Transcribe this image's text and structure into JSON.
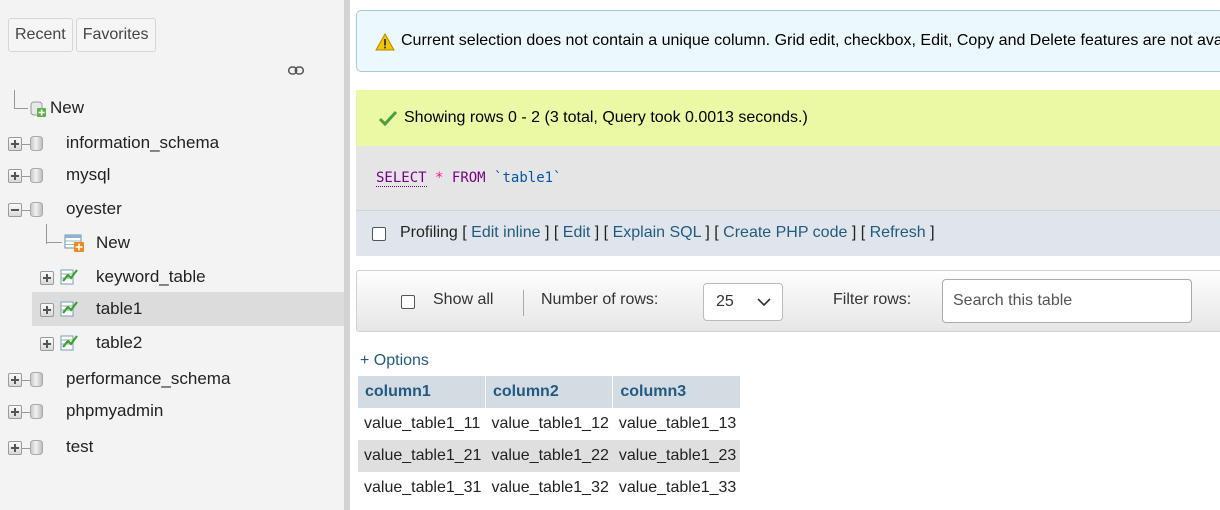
{
  "sidebar": {
    "tabs": [
      "Recent",
      "Favorites"
    ],
    "tree": {
      "new_label": "New",
      "databases": [
        {
          "name": "information_schema"
        },
        {
          "name": "mysql"
        },
        {
          "name": "oyester"
        },
        {
          "name": "performance_schema"
        },
        {
          "name": "phpmyadmin"
        },
        {
          "name": "test"
        }
      ],
      "oyester_children": {
        "new_label": "New",
        "tables": [
          "keyword_table",
          "table1",
          "table2"
        ],
        "selected": "table1"
      }
    }
  },
  "main": {
    "notice": "Current selection does not contain a unique column. Grid edit, checkbox, Edit, Copy and Delete features are not available.",
    "success": "Showing rows 0 - 2 (3 total, Query took 0.0013 seconds.)",
    "sql": {
      "select": "SELECT",
      "star": "*",
      "from": "FROM",
      "table": "`table1`"
    },
    "profiling": {
      "label": "Profiling",
      "links": [
        "Edit inline",
        "Edit",
        "Explain SQL",
        "Create PHP code",
        "Refresh"
      ]
    },
    "navbar": {
      "show_all": "Show all",
      "number_of_rows_label": "Number of rows:",
      "rows_value": "25",
      "filter_label": "Filter rows:",
      "search_placeholder": "Search this table"
    },
    "options_link": "+ Options",
    "table": {
      "columns": [
        "column1",
        "column2",
        "column3"
      ],
      "rows": [
        [
          "value_table1_11",
          "value_table1_12",
          "value_table1_13"
        ],
        [
          "value_table1_21",
          "value_table1_22",
          "value_table1_23"
        ],
        [
          "value_table1_31",
          "value_table1_32",
          "value_table1_33"
        ]
      ]
    }
  },
  "colors": {
    "link": "#235a81",
    "notice_bg": "#ebf8fd",
    "success_bg": "#ebf8a4",
    "header_bg": "#d3dce3"
  }
}
